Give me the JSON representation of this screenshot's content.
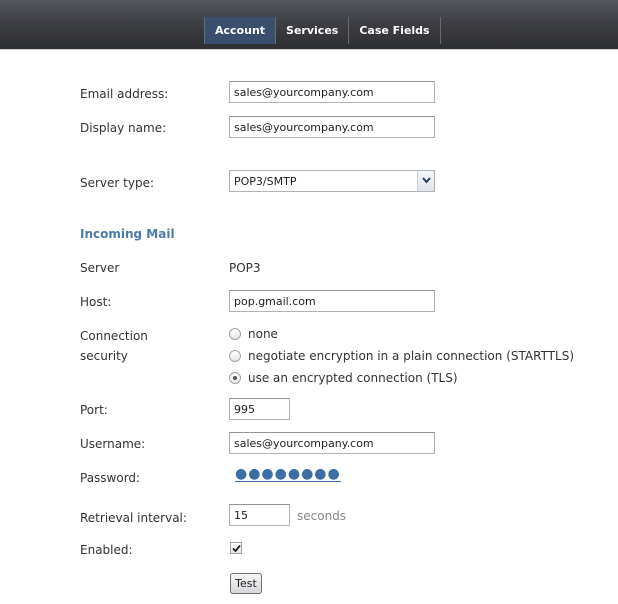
{
  "nav": {
    "tabs": [
      {
        "label": "Account",
        "active": true
      },
      {
        "label": "Services",
        "active": false
      },
      {
        "label": "Case Fields",
        "active": false
      }
    ]
  },
  "account": {
    "email_label": "Email address:",
    "email_value": "sales@yourcompany.com",
    "display_name_label": "Display name:",
    "display_name_value": "sales@yourcompany.com",
    "server_type_label": "Server type:",
    "server_type_value": "POP3/SMTP"
  },
  "incoming": {
    "section_title": "Incoming Mail",
    "server_label": "Server",
    "server_value": "POP3",
    "host_label": "Host:",
    "host_value": "pop.gmail.com",
    "security_label_line1": "Connection",
    "security_label_line2": "security",
    "security_options": [
      {
        "label": "none",
        "checked": false
      },
      {
        "label": "negotiate encryption in a plain connection (STARTTLS)",
        "checked": false
      },
      {
        "label": "use an encrypted connection (TLS)",
        "checked": true
      }
    ],
    "port_label": "Port:",
    "port_value": "995",
    "username_label": "Username:",
    "username_value": "sales@yourcompany.com",
    "password_label": "Password:",
    "password_mask": "●●●●●●●●",
    "interval_label": "Retrieval interval:",
    "interval_value": "15",
    "interval_unit": "seconds",
    "enabled_label": "Enabled:",
    "enabled_checked": true,
    "test_button": "Test"
  },
  "colors": {
    "section_title": "#4b7bab",
    "active_tab": "#3a4f6e",
    "password_link": "#3a6ea5"
  }
}
